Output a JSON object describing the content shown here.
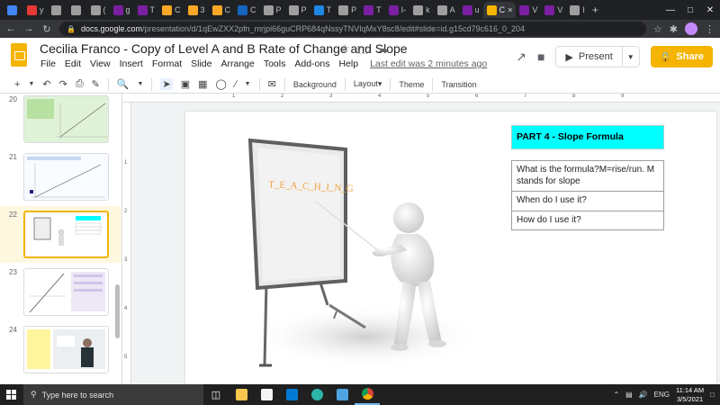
{
  "browser": {
    "tabs": [
      {
        "label": "",
        "color": "#4285f4"
      },
      {
        "label": "y",
        "color": "#e53935"
      },
      {
        "label": "",
        "color": "#9e9e9e"
      },
      {
        "label": "",
        "color": "#9e9e9e"
      },
      {
        "label": "(",
        "color": "#9e9e9e"
      },
      {
        "label": "g",
        "color": "#7b1fa2"
      },
      {
        "label": "T",
        "color": "#7b1fa2"
      },
      {
        "label": "C",
        "color": "#f9a825"
      },
      {
        "label": "3",
        "color": "#f9a825"
      },
      {
        "label": "C",
        "color": "#f9a825"
      },
      {
        "label": "C",
        "color": "#1565c0"
      },
      {
        "label": "P",
        "color": "#9e9e9e"
      },
      {
        "label": "P",
        "color": "#9e9e9e"
      },
      {
        "label": "T",
        "color": "#1e88e5"
      },
      {
        "label": "P",
        "color": "#9e9e9e"
      },
      {
        "label": "T",
        "color": "#7b1fa2"
      },
      {
        "label": "I-",
        "color": "#7b1fa2"
      },
      {
        "label": "k",
        "color": "#9e9e9e"
      },
      {
        "label": "A",
        "color": "#9e9e9e"
      },
      {
        "label": "u",
        "color": "#7b1fa2"
      },
      {
        "label": "C",
        "color": "#f4b400",
        "active": true
      },
      {
        "label": "V",
        "color": "#7b1fa2"
      },
      {
        "label": "V",
        "color": "#7b1fa2"
      },
      {
        "label": "I",
        "color": "#9e9e9e"
      }
    ],
    "new_tab": "+",
    "url_host": "docs.google.com",
    "url_path": "/presentation/d/1qEwZXX2pfn_mrjpi66guCRP684qNssyTNVIqMxY8sc8/edit#slide=id.g15cd79c616_0_204"
  },
  "doc": {
    "title": "Cecilia Franco - Copy of Level A and B Rate of Change  and Slope",
    "menu": [
      "File",
      "Edit",
      "View",
      "Insert",
      "Format",
      "Slide",
      "Arrange",
      "Tools",
      "Add-ons",
      "Help"
    ],
    "last_edit": "Last edit was 2 minutes ago",
    "present_label": "Present",
    "share_label": "Share"
  },
  "toolbar": {
    "background": "Background",
    "layout": "Layout▾",
    "theme": "Theme",
    "transition": "Transition"
  },
  "filmstrip": {
    "slides": [
      {
        "num": "20"
      },
      {
        "num": "21"
      },
      {
        "num": "22",
        "selected": true
      },
      {
        "num": "23"
      },
      {
        "num": "24"
      }
    ]
  },
  "ruler": {
    "h": [
      "1",
      "2",
      "3",
      "4",
      "5",
      "6",
      "7",
      "8",
      "9"
    ],
    "v": [
      "1",
      "2",
      "3",
      "4",
      "5"
    ]
  },
  "slide": {
    "board_text": "T_E_A_C_H_I_N_G",
    "part_title": "PART 4 - Slope Formula",
    "rows": [
      "What is the formula?M=rise/run. M stands for slope",
      "When do I use it?",
      "How do I use it?"
    ]
  },
  "taskbar": {
    "search_placeholder": "Type here to search",
    "lang": "ENG",
    "time": "11:14 AM",
    "date": "3/5/2021"
  },
  "colors": {
    "accent": "#f4b400",
    "part_box": "#00ffff"
  }
}
